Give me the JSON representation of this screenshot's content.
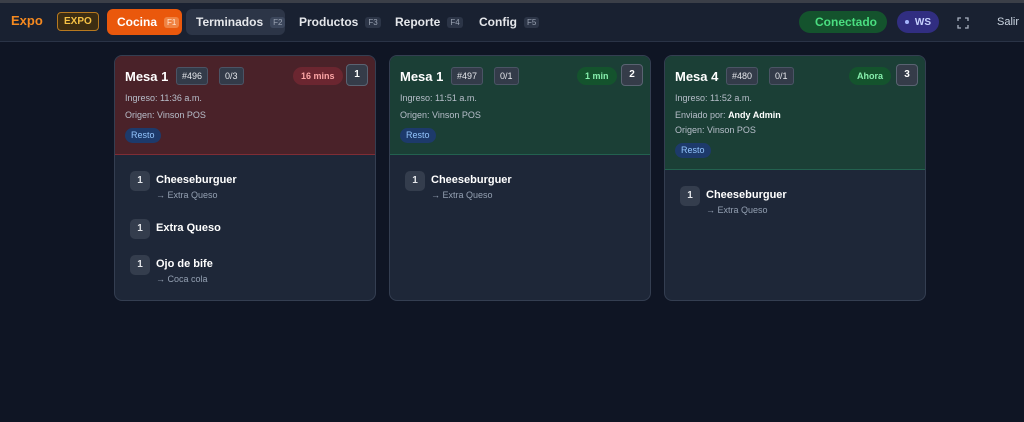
{
  "navbar": {
    "brand": "Expo",
    "mode_badge": "EXPO",
    "tabs": [
      {
        "label": "Cocina",
        "key": "F1"
      },
      {
        "label": "Terminados",
        "key": "F2"
      },
      {
        "label": "Productos",
        "key": "F3"
      },
      {
        "label": "Reporte",
        "key": "F4"
      },
      {
        "label": "Config",
        "key": "F5"
      }
    ],
    "connection_status": "Conectado",
    "ws_label": "WS",
    "logout_label": "Salir"
  },
  "colors": {
    "accent": "#ea580c",
    "late": "#4a2229",
    "on_time": "#1b3f36",
    "connected": "#22c55e"
  },
  "orders": [
    {
      "table": "Mesa 1",
      "id": "#496",
      "progress": "0/3",
      "elapsed": "16 mins",
      "position": "1",
      "received": "Ingreso: 11:36 a.m.",
      "origin": "Origen: Vinson POS",
      "tag": "Resto",
      "items": [
        {
          "qty": "1",
          "name": "Cheeseburguer",
          "mod": "→ Extra Queso"
        },
        {
          "qty": "1",
          "name": "Extra Queso",
          "mod": ""
        },
        {
          "qty": "1",
          "name": "Ojo de bife",
          "mod": "→ Coca cola"
        }
      ]
    },
    {
      "table": "Mesa 1",
      "id": "#497",
      "progress": "0/1",
      "elapsed": "1 min",
      "position": "2",
      "received": "Ingreso: 11:51 a.m.",
      "origin": "Origen: Vinson POS",
      "tag": "Resto",
      "items": [
        {
          "qty": "1",
          "name": "Cheeseburguer",
          "mod": "→ Extra Queso"
        }
      ]
    },
    {
      "table": "Mesa 4",
      "id": "#480",
      "progress": "0/1",
      "elapsed": "Ahora",
      "position": "3",
      "received": "Ingreso: 11:52 a.m.",
      "sent_by_label": "Enviado por:",
      "sent_by": "Andy Admin",
      "origin": "Origen: Vinson POS",
      "tag": "Resto",
      "items": [
        {
          "qty": "1",
          "name": "Cheeseburguer",
          "mod": "→ Extra Queso"
        }
      ]
    }
  ]
}
